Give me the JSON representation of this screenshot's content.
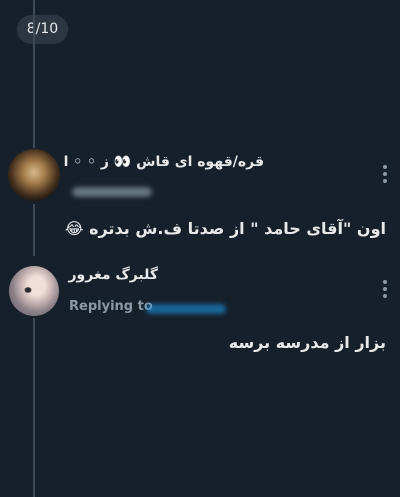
{
  "pagination": {
    "label": "8/10"
  },
  "replies": [
    {
      "author_name": "قره/قهوه ای قاش 👀 ز ◦ ◦ ا",
      "text": "اون \"آقای حامد \" از صدتا ف.ش بدتره 😂"
    },
    {
      "author_name": "گلبرگ مغرور",
      "replying_label": "Replying to",
      "text": "بزار از مدرسه برسه"
    }
  ],
  "icons": {
    "more": "more-options-icon"
  }
}
